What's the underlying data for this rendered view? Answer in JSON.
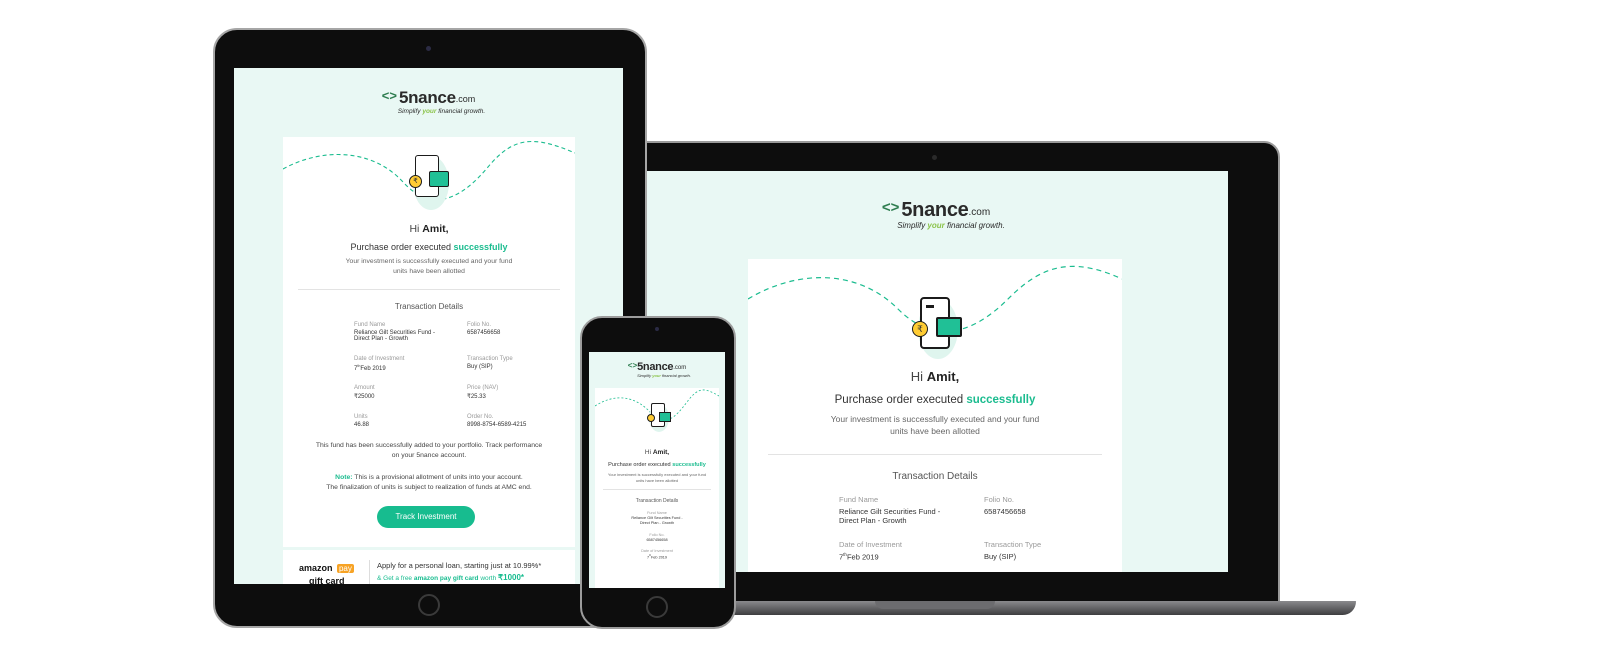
{
  "brand": {
    "chevron": "<>",
    "name": "5nance",
    "domain": ".com",
    "tagline_pre": "Simplify ",
    "tagline_hl": "your",
    "tagline_post": " financial growth."
  },
  "email": {
    "greeting_pre": "Hi ",
    "greeting_name": "Amit,",
    "headline_pre": "Purchase order executed ",
    "headline_hl": "successfully",
    "subline_1": "Your investment is successfully executed and your fund",
    "subline_2": "units have been allotted",
    "section_title": "Transaction Details",
    "fields": {
      "fund_name_label": "Fund Name",
      "fund_name_value_1": "Reliance Gilt Securities Fund -",
      "fund_name_value_2": "Direct Plan - Growth",
      "folio_label": "Folio No.",
      "folio_value": "6587456658",
      "date_label": "Date of Investment",
      "date_day": "7",
      "date_sup": "th",
      "date_rest": "Feb 2019",
      "type_label": "Transaction Type",
      "type_value": "Buy (SIP)",
      "amount_label": "Amount",
      "amount_value": "₹25000",
      "price_label": "Price (NAV)",
      "price_value": "₹25.33",
      "units_label": "Units",
      "units_value": "46.88",
      "order_label": "Order No.",
      "order_value": "8998-8754-6589-4215"
    },
    "portfolio_1": "This fund has been successfully added to your portfolio. Track performance",
    "portfolio_2": "on your 5nance account.",
    "note_label": "Note:",
    "note_1": " This is a provisional allotment of units into your account.",
    "note_2": "The finalization of units is subject to realization of funds at AMC end.",
    "cta_label": "Track Investment"
  },
  "promo": {
    "amazon_1": "amazon",
    "amazon_pay": "pay",
    "gift_card": "gift card",
    "line_1": "Apply for a personal loan, starting just at 10.99%*",
    "line_2_pre": "& Get a free ",
    "line_2_hl": "amazon pay gift card",
    "line_2_mid": " worth ",
    "line_2_amount": "₹1000*"
  },
  "colors": {
    "accent": "#17bc8f",
    "screen_bg": "#e9f8f4",
    "device_frame": "#111111",
    "laptop_base": "#5d5d60"
  }
}
